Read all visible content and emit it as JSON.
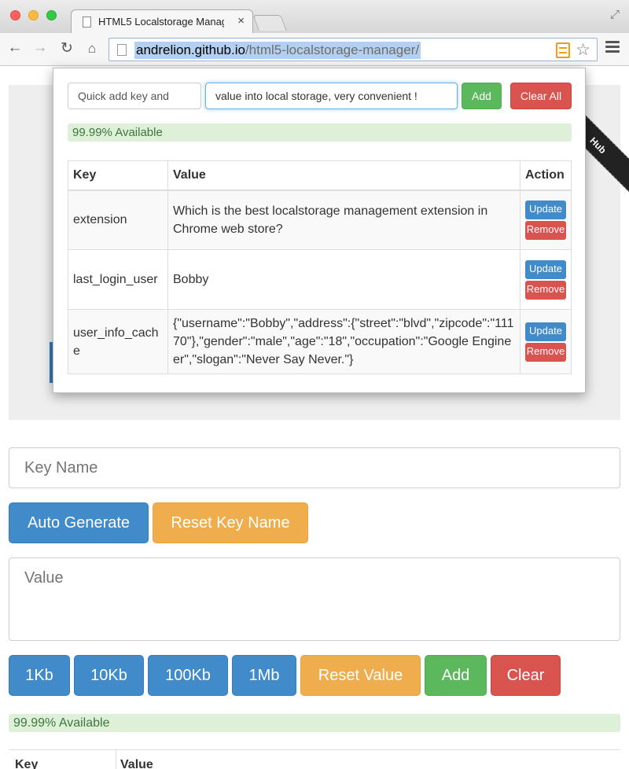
{
  "browser": {
    "tab_title": "HTML5 Localstorage Manager",
    "tab_close": "×",
    "url_host": "andrelion.github.io",
    "url_path": "/html5-localstorage-manager/",
    "icons": [
      "back-icon",
      "forward-icon",
      "reload-icon",
      "home-icon",
      "page-icon",
      "extension-icon",
      "star-icon",
      "menu-icon",
      "fullscreen-icon"
    ]
  },
  "popup": {
    "key_input_value": "Quick add key and",
    "value_input_value": "value into local storage, very convenient !",
    "add_label": "Add",
    "clear_all_label": "Clear All",
    "available": "99.99% Available",
    "table": {
      "headers": [
        "Key",
        "Value",
        "Action"
      ],
      "rows": [
        {
          "key": "extension",
          "value": "Which is the best localstorage management extension in Chrome web store?"
        },
        {
          "key": "last_login_user",
          "value": "Bobby"
        },
        {
          "key": "user_info_cache",
          "value": "{\"username\":\"Bobby\",\"address\":{\"street\":\"blvd\",\"zipcode\":\"11170\"},\"gender\":\"male\",\"age\":\"18\",\"occupation\":\"Google Engineer\",\"slogan\":\"Never Say Never.\"}"
        }
      ],
      "update_label": "Update",
      "remove_label": "Remove"
    }
  },
  "page": {
    "ribbon_text": "Hub",
    "key_placeholder": "Key Name",
    "auto_generate_label": "Auto Generate",
    "reset_key_label": "Reset Key Name",
    "value_placeholder": "Value",
    "size_buttons": [
      "1Kb",
      "10Kb",
      "100Kb",
      "1Mb"
    ],
    "reset_value_label": "Reset Value",
    "add_label": "Add",
    "clear_label": "Clear",
    "available": "99.99% Available",
    "table_headers": [
      "Key",
      "Value"
    ]
  },
  "colors": {
    "primary": "#428bca",
    "warning": "#f0ad4e",
    "success": "#5cb85c",
    "danger": "#d9534f",
    "available_bg": "#dff0d8",
    "available_text": "#3c763d"
  }
}
